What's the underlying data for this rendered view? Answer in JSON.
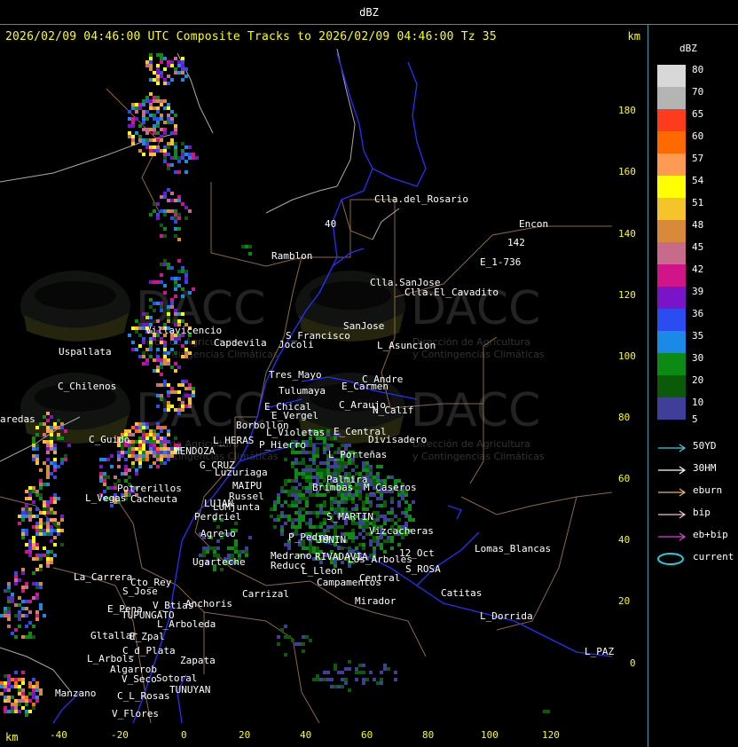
{
  "window_title": "dBZ",
  "header": {
    "title": "2026/02/09 04:46:00 UTC Composite Tracks to 2026/02/09 04:46:00 Tz 35",
    "unit": "km"
  },
  "axes": {
    "x_unit": "km",
    "x_ticks": [
      "-40",
      "-20",
      "0",
      "20",
      "40",
      "60",
      "80",
      "100",
      "120"
    ],
    "y_ticks": [
      "180",
      "160",
      "140",
      "120",
      "100",
      "80",
      "60",
      "40",
      "20",
      "0"
    ]
  },
  "legend": {
    "title": "dBZ",
    "levels": [
      {
        "label": "80",
        "color": "#d8d8d8"
      },
      {
        "label": "70",
        "color": "#b4b4b4"
      },
      {
        "label": "65",
        "color": "#ff3b1e"
      },
      {
        "label": "60",
        "color": "#ff6a00"
      },
      {
        "label": "57",
        "color": "#ff9a55"
      },
      {
        "label": "54",
        "color": "#ffff00"
      },
      {
        "label": "51",
        "color": "#f5c42a"
      },
      {
        "label": "48",
        "color": "#d88a3a"
      },
      {
        "label": "45",
        "color": "#c86a8a"
      },
      {
        "label": "42",
        "color": "#d2148a"
      },
      {
        "label": "39",
        "color": "#7a14c8"
      },
      {
        "label": "36",
        "color": "#2a4cf0"
      },
      {
        "label": "35",
        "color": "#1a8ae6"
      },
      {
        "label": "30",
        "color": "#0c8a14"
      },
      {
        "label": "20",
        "color": "#0a5a0a"
      },
      {
        "label": "10",
        "color": "#3f3f9a"
      },
      {
        "label": "5",
        "color": ""
      }
    ],
    "tracks": [
      {
        "label": "50YD",
        "color": "#3fd0e0"
      },
      {
        "label": "30HM",
        "color": "#ffffff"
      },
      {
        "label": "eburn",
        "color": "#e6b86a"
      },
      {
        "label": "bip",
        "color": "#f0c0d0"
      },
      {
        "label": "eb+bip",
        "color": "#e040e0"
      },
      {
        "label": "current",
        "color": "#20d0e0",
        "icon": "ellipse"
      }
    ]
  },
  "watermark": {
    "brand": "DACC",
    "line1": "Dirección de Agricultura",
    "line2": "y Contingencias Climáticas",
    "line1_short": "ción de Agricultura",
    "line2_short": "y Contingencias Climáticas"
  },
  "places": [
    {
      "name": "Clla.del_Rosario"
    },
    {
      "name": "Encon"
    },
    {
      "name": "142"
    },
    {
      "name": "E_1-736"
    },
    {
      "name": "Ramblon"
    },
    {
      "name": "40"
    },
    {
      "name": "Clla.SanJose"
    },
    {
      "name": "Clla.El_Cavadito"
    },
    {
      "name": "Villavicencio"
    },
    {
      "name": "Capdevila"
    },
    {
      "name": "S_Francisco"
    },
    {
      "name": "Jocoli"
    },
    {
      "name": "SanJose"
    },
    {
      "name": "L_Asuncion"
    },
    {
      "name": "Uspallata"
    },
    {
      "name": "Tres_Mayo"
    },
    {
      "name": "C_Andre"
    },
    {
      "name": "C_Chilenos"
    },
    {
      "name": "Tulumaya"
    },
    {
      "name": "E_Carmen"
    },
    {
      "name": "E_Chical"
    },
    {
      "name": "C_Araujo"
    },
    {
      "name": "N_Calif"
    },
    {
      "name": "E_Vergel"
    },
    {
      "name": "aredas"
    },
    {
      "name": "Borbollon"
    },
    {
      "name": "L_Violetas"
    },
    {
      "name": "E_Central"
    },
    {
      "name": "Divisadero"
    },
    {
      "name": "C_Guido"
    },
    {
      "name": "L_HERAS"
    },
    {
      "name": "P_Hierro"
    },
    {
      "name": "MENDOZA"
    },
    {
      "name": "L_Porteñas"
    },
    {
      "name": "G_CRUZ"
    },
    {
      "name": "Luzuriaga"
    },
    {
      "name": "Palmira"
    },
    {
      "name": "MAIPU"
    },
    {
      "name": "Brimbas"
    },
    {
      "name": "M_Caseros"
    },
    {
      "name": "Potrerillos"
    },
    {
      "name": "Russel"
    },
    {
      "name": "L_Vegas"
    },
    {
      "name": "Cacheuta"
    },
    {
      "name": "LUJAN"
    },
    {
      "name": "LUMjunta"
    },
    {
      "name": "S_MARTIN"
    },
    {
      "name": "Perdriel"
    },
    {
      "name": "Agrelo"
    },
    {
      "name": "P_Pedra"
    },
    {
      "name": "JUNIN"
    },
    {
      "name": "Vizcacheras"
    },
    {
      "name": "Ugarteche"
    },
    {
      "name": "Medrano"
    },
    {
      "name": "Reducc"
    },
    {
      "name": "RIVADAVIA"
    },
    {
      "name": "Los_Arboles"
    },
    {
      "name": "L_Lleon"
    },
    {
      "name": "12_Oct"
    },
    {
      "name": "S_ROSA"
    },
    {
      "name": "Lomas_Blancas"
    },
    {
      "name": "La_Carrera"
    },
    {
      "name": "Cto_Rey"
    },
    {
      "name": "S_Jose"
    },
    {
      "name": "Carrizal"
    },
    {
      "name": "Campamentos"
    },
    {
      "name": "Central"
    },
    {
      "name": "Catitas"
    },
    {
      "name": "E_Pena"
    },
    {
      "name": "V_Btias"
    },
    {
      "name": "Anchoris"
    },
    {
      "name": "TUPUNGATO"
    },
    {
      "name": "Mirador"
    },
    {
      "name": "L_Dorrida"
    },
    {
      "name": "L_Arboleda"
    },
    {
      "name": "Gltallar"
    },
    {
      "name": "E_Zpal"
    },
    {
      "name": "L_PAZ"
    },
    {
      "name": "C_d_Plata"
    },
    {
      "name": "L_Arbols"
    },
    {
      "name": "Zapata"
    },
    {
      "name": "Algarrob"
    },
    {
      "name": "V_Seco"
    },
    {
      "name": "Sotoral"
    },
    {
      "name": "TUNUYAN"
    },
    {
      "name": "Manzano"
    },
    {
      "name": "C_L_Rosas"
    },
    {
      "name": "V_Flores"
    },
    {
      "name": "88"
    },
    {
      "name": "94"
    }
  ]
}
